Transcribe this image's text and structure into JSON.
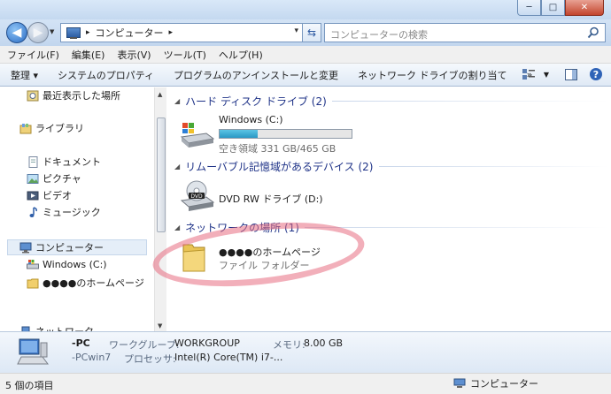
{
  "window": {
    "minimize_glyph": "─",
    "maximize_glyph": "□",
    "close_glyph": "✕"
  },
  "address": {
    "path": "コンピューター",
    "separator": "▸",
    "dropdown": "▾"
  },
  "search": {
    "placeholder": "コンピューターの検索"
  },
  "menu": {
    "items": [
      "ファイル(F)",
      "編集(E)",
      "表示(V)",
      "ツール(T)",
      "ヘルプ(H)"
    ]
  },
  "toolbar": {
    "items": [
      "整理 ▾",
      "システムのプロパティ",
      "プログラムのアンインストールと変更",
      "ネットワーク ドライブの割り当て",
      "»"
    ]
  },
  "sidebar": {
    "items": [
      {
        "label": "最近表示した場所",
        "icon": "recent-places-icon"
      },
      {
        "label": "ライブラリ",
        "icon": "libraries-icon"
      },
      {
        "label": "ドキュメント",
        "icon": "documents-icon"
      },
      {
        "label": "ピクチャ",
        "icon": "pictures-icon"
      },
      {
        "label": "ビデオ",
        "icon": "videos-icon"
      },
      {
        "label": "ミュージック",
        "icon": "music-icon"
      },
      {
        "label": "コンピューター",
        "icon": "computer-icon"
      },
      {
        "label": "Windows (C:)",
        "icon": "drive-icon"
      },
      {
        "label": "●●●●のホームページ",
        "icon": "folder-icon"
      },
      {
        "label": "ネットワーク",
        "icon": "network-icon"
      }
    ]
  },
  "groups": {
    "hdd": {
      "title": "ハード ディスク ドライブ (2)"
    },
    "removable": {
      "title": "リムーバブル記憶域があるデバイス (2)"
    },
    "network": {
      "title": "ネットワークの場所 (1)"
    }
  },
  "drives": {
    "c": {
      "name": "Windows (C:)",
      "space": "空き領域 331 GB/465 GB",
      "used_fraction": 0.288
    },
    "dvd": {
      "name": "DVD RW ドライブ (D:)"
    },
    "net_folder": {
      "name": "●●●●のホームページ",
      "type": "ファイル フォルダー"
    }
  },
  "details": {
    "name": "-PC",
    "full_name": "-PCwin7",
    "workgroup_label": "ワークグループ:",
    "workgroup_value": "WORKGROUP",
    "memory_label": "メモリ:",
    "memory_value": "8.00 GB",
    "processor_label": "プロセッサ:",
    "processor_value": "Intel(R) Core(TM) i7-..."
  },
  "status": {
    "count": "5 個の項目",
    "location": "コンピューター"
  },
  "colors": {
    "group_title": "#1e3287",
    "bar_fill": "#2a98c4",
    "highlight": "#e86e82"
  }
}
